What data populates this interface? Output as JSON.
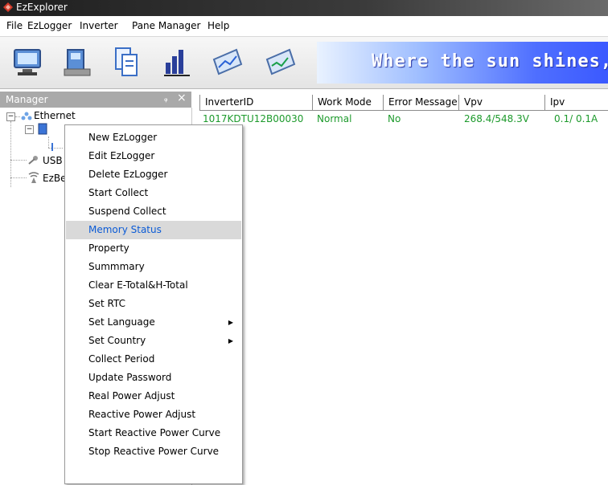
{
  "window": {
    "title": "EzExplorer"
  },
  "menubar": {
    "items": [
      "File",
      "EzLogger",
      "Inverter",
      "Pane Manager",
      "Help"
    ]
  },
  "toolbar": {
    "buttons": [
      {
        "icon": "monitor-icon"
      },
      {
        "icon": "logger-device-icon"
      },
      {
        "icon": "documents-icon"
      },
      {
        "icon": "bar-chart-icon"
      },
      {
        "icon": "tablet-chart-icon"
      },
      {
        "icon": "tablet-graph-icon"
      }
    ],
    "banner_text": "Where the sun shines,"
  },
  "manager": {
    "title": "Manager",
    "pin": "ᵩ",
    "close": "×",
    "tree": {
      "ethernet": "Ethernet",
      "usb": "USB",
      "ezbe": "EzBe"
    }
  },
  "grid": {
    "columns": [
      "InverterID",
      "Work Mode",
      "Error Message",
      "Vpv",
      "Ipv"
    ],
    "rows": [
      {
        "inverter_id": "1017KDTU12B00030",
        "work_mode": "Normal",
        "error_message": "No",
        "vpv": "268.4/548.3V",
        "ipv": "0.1/ 0.1A"
      }
    ],
    "text_color": "#1d9a2c"
  },
  "context_menu": {
    "selected_index": 5,
    "items": [
      {
        "label": "New EzLogger",
        "submenu": false
      },
      {
        "label": "Edit EzLogger",
        "submenu": false
      },
      {
        "label": "Delete EzLogger",
        "submenu": false
      },
      {
        "label": "Start Collect",
        "submenu": false
      },
      {
        "label": "Suspend Collect",
        "submenu": false
      },
      {
        "label": "Memory Status",
        "submenu": false
      },
      {
        "label": "Property",
        "submenu": false
      },
      {
        "label": "Summmary",
        "submenu": false
      },
      {
        "label": "Clear E-Total&H-Total",
        "submenu": false
      },
      {
        "label": "Set RTC",
        "submenu": false
      },
      {
        "label": "Set Language",
        "submenu": true
      },
      {
        "label": "Set Country",
        "submenu": true
      },
      {
        "label": "Collect Period",
        "submenu": false
      },
      {
        "label": "Update Password",
        "submenu": false
      },
      {
        "label": "Real Power Adjust",
        "submenu": false
      },
      {
        "label": "Reactive Power Adjust",
        "submenu": false
      },
      {
        "label": "Start Reactive Power Curve",
        "submenu": false
      },
      {
        "label": "Stop Reactive Power Curve",
        "submenu": false
      }
    ],
    "submenu_arrow": "▶"
  },
  "colors": {
    "accent_selected_text": "#0b5bd6",
    "banner_blue": "#3b59ff",
    "pane_header": "#a9a9a9"
  }
}
